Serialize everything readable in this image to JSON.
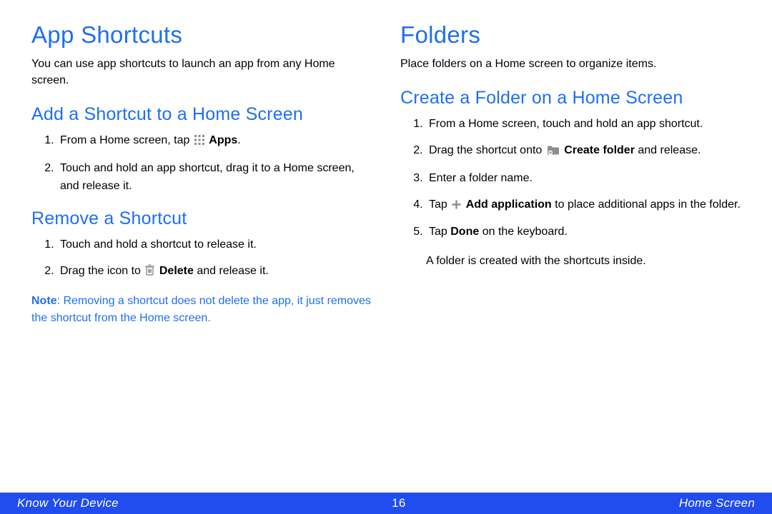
{
  "left": {
    "h1": "App Shortcuts",
    "lead": "You can use app shortcuts to launch an app from any Home screen.",
    "sectionA": {
      "h2": "Add a Shortcut to a Home Screen",
      "step1_pre": "From a Home screen, tap ",
      "step1_bold": "Apps",
      "step1_post": ".",
      "step2": "Touch and hold an app shortcut, drag it to a Home screen, and release it."
    },
    "sectionB": {
      "h2": "Remove a Shortcut",
      "step1": "Touch and hold a shortcut to release it.",
      "step2_pre": "Drag the icon to ",
      "step2_bold": "Delete",
      "step2_post": " and release it.",
      "note_label": "Note",
      "note_body": ": Removing a shortcut does not delete the app, it just removes the shortcut from the Home screen."
    }
  },
  "right": {
    "h1": "Folders",
    "lead": "Place folders on a Home screen to organize items.",
    "sectionA": {
      "h2": "Create a Folder on a Home Screen",
      "step1": "From a Home screen, touch and hold an app shortcut.",
      "step2_pre": "Drag the shortcut onto ",
      "step2_bold": "Create folder",
      "step2_post": " and release.",
      "step3": "Enter a folder name.",
      "step4_pre": "Tap ",
      "step4_bold": "Add application",
      "step4_post": " to place additional apps in the folder.",
      "step5_pre": "Tap ",
      "step5_bold": "Done",
      "step5_post": " on the keyboard.",
      "closing": "A folder is created with the shortcuts inside."
    }
  },
  "footer": {
    "left": "Know Your Device",
    "page": "16",
    "right": "Home Screen"
  }
}
